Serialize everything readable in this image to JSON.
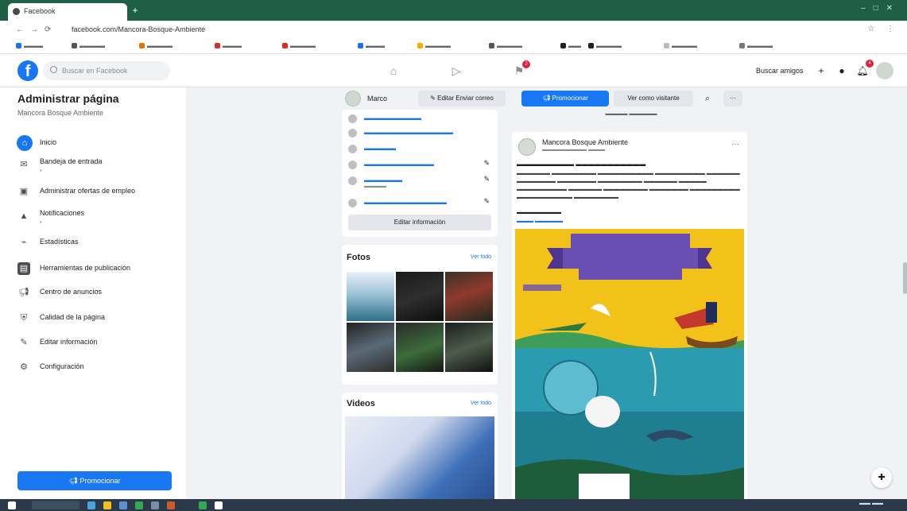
{
  "browser": {
    "tab_title": "Facebook",
    "url": "facebook.com/Mancora-Bosque-Ambiente"
  },
  "fb": {
    "logo": "f",
    "search_placeholder": "Buscar en Facebook",
    "find_friends": "Buscar amigos",
    "notifications_count": "4",
    "nav_badge": "2"
  },
  "sidebar": {
    "title": "Administrar página",
    "page_name": "Mancora Bosque Ambiente",
    "items": [
      {
        "label": "Inicio",
        "icon": "home-icon"
      },
      {
        "label": "Bandeja de entrada",
        "icon": "inbox-icon"
      },
      {
        "label": "Administrar ofertas de empleo",
        "icon": "briefcase-icon"
      },
      {
        "label": "Notificaciones",
        "icon": "bell-icon"
      },
      {
        "label": "Estadísticas",
        "icon": "chart-icon"
      },
      {
        "label": "Herramientas de publicación",
        "icon": "tools-icon"
      },
      {
        "label": "Centro de anuncios",
        "icon": "megaphone-icon"
      },
      {
        "label": "Calidad de la página",
        "icon": "shield-icon"
      },
      {
        "label": "Editar información",
        "icon": "pencil-icon"
      },
      {
        "label": "Configuración",
        "icon": "gear-icon"
      }
    ],
    "promote_label": "Promocionar"
  },
  "toolbar": {
    "name": "Marco",
    "edit_button": "Editar Enviar correo",
    "promote_button": "Promocionar",
    "view_as_button": "Ver como visitante",
    "search_icon": "search-icon",
    "more": "···"
  },
  "info": {
    "edit_label": "Editar información"
  },
  "photos": {
    "header": "Fotos",
    "see_all": "Ver todo"
  },
  "videos": {
    "header": "Videos",
    "see_all": "Ver todo"
  },
  "post": {
    "author": "Mancora Bosque Ambiente",
    "more": "···"
  },
  "colors": {
    "fb_blue": "#1877f2",
    "background": "#f0f2f5",
    "tab_bar": "#1f5f46",
    "post_image_yellow": "#f2c21a",
    "banner_purple": "#6a4fb2"
  }
}
